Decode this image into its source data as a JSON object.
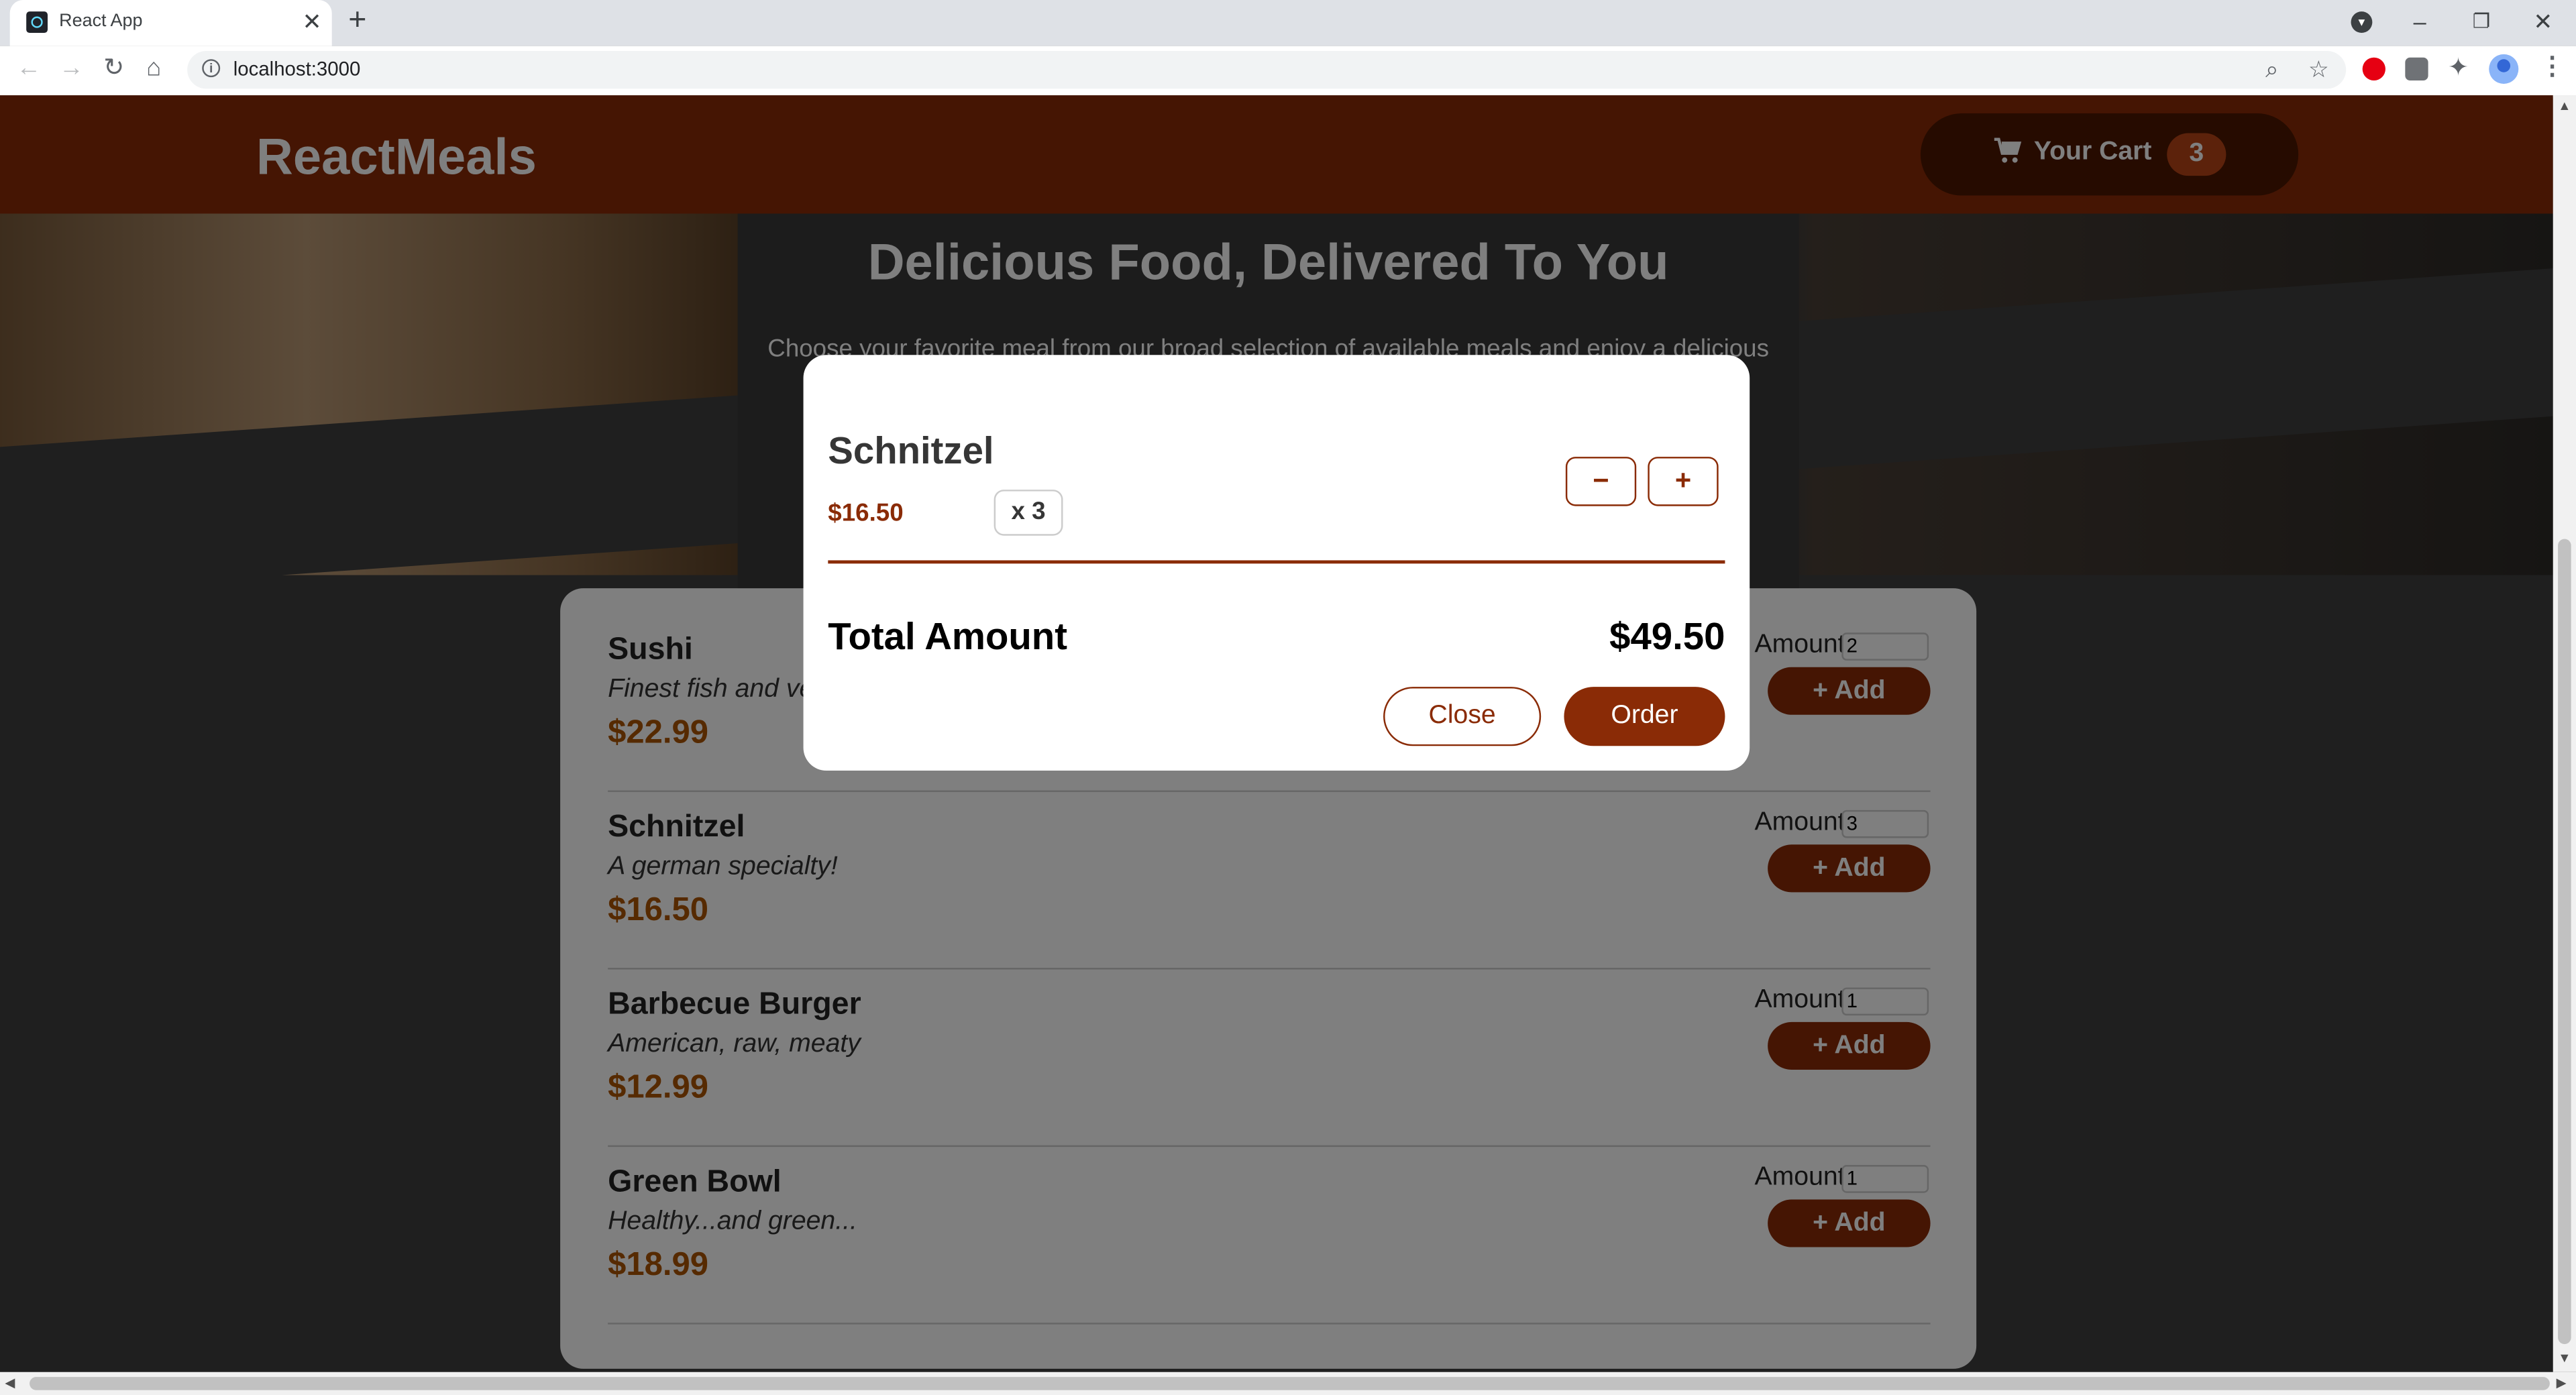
{
  "browser": {
    "tab_title": "React App",
    "tab_close": "✕",
    "new_tab": "+",
    "url": "localhost:3000",
    "controls": {
      "minimize": "–",
      "restore": "❐",
      "close": "✕"
    }
  },
  "header": {
    "logo": "ReactMeals",
    "cart_label": "Your Cart",
    "cart_count": "3"
  },
  "summary": {
    "title": "Delicious Food, Delivered To You",
    "text": "Choose your favorite meal from our broad selection of available meals and enjoy a delicious"
  },
  "meals": [
    {
      "name": "Sushi",
      "description": "Finest fish and veggies",
      "price": "$22.99",
      "amount_label": "Amount",
      "amount": "2",
      "add_label": "+ Add"
    },
    {
      "name": "Schnitzel",
      "description": "A german specialty!",
      "price": "$16.50",
      "amount_label": "Amount",
      "amount": "3",
      "add_label": "+ Add"
    },
    {
      "name": "Barbecue Burger",
      "description": "American, raw, meaty",
      "price": "$12.99",
      "amount_label": "Amount",
      "amount": "1",
      "add_label": "+ Add"
    },
    {
      "name": "Green Bowl",
      "description": "Healthy...and green...",
      "price": "$18.99",
      "amount_label": "Amount",
      "amount": "1",
      "add_label": "+ Add"
    }
  ],
  "cart_modal": {
    "item": {
      "name": "Schnitzel",
      "price": "$16.50",
      "quantity": "x 3"
    },
    "remove_label": "−",
    "add_label": "+",
    "total_label": "Total Amount",
    "total_value": "$49.50",
    "close_label": "Close",
    "order_label": "Order"
  },
  "colors": {
    "brand": "#8a2b06",
    "cart_button": "#4d1601",
    "badge": "#b94517",
    "price": "#ad5502"
  },
  "icons": [
    "react-favicon",
    "back-icon",
    "forward-icon",
    "reload-icon",
    "home-icon",
    "info-icon",
    "zoom-icon",
    "star-icon",
    "extension-icon",
    "profile-avatar",
    "menu-icon",
    "cart-icon"
  ]
}
